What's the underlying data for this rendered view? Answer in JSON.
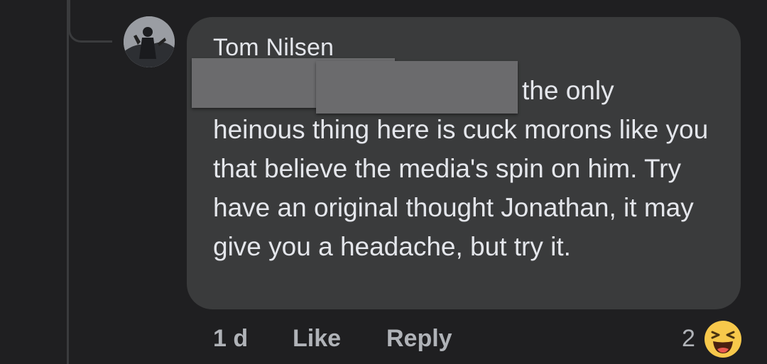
{
  "comment": {
    "author": "Tom Nilsen",
    "text_first_line": "the only",
    "text_rest": "heinous thing here is cuck morons like you that believe the media's spin on him. Try have an original thought Jonathan, it may give you a headache, but try it.",
    "age": "1 d",
    "like_label": "Like",
    "reply_label": "Reply",
    "reaction_count": "2",
    "reaction_icon": "laughing-face-icon"
  }
}
